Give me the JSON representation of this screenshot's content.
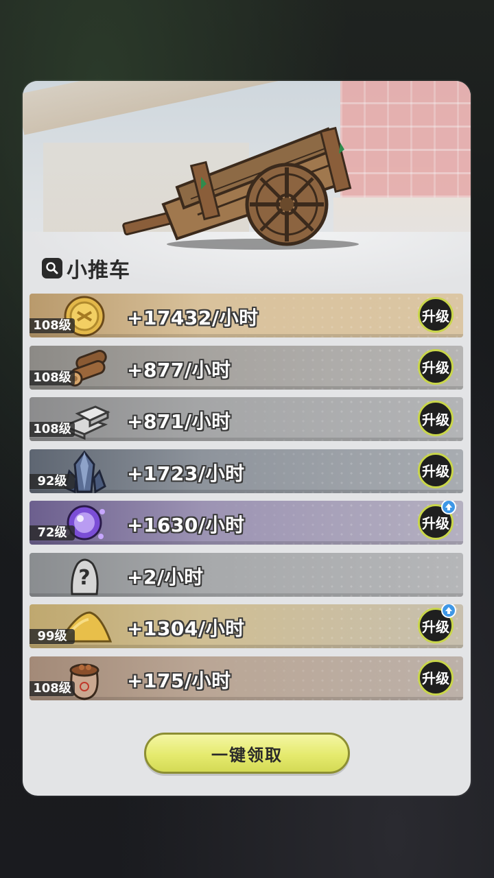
{
  "panel": {
    "title": "小推车",
    "title_icon": "search-icon",
    "scene_image": "wooden-cart"
  },
  "resources": [
    {
      "name": "gold-coin",
      "level": "108级",
      "rate": "+17432/小时",
      "upgrade_label": "升级",
      "upgrade_available": false
    },
    {
      "name": "wood-logs",
      "level": "108级",
      "rate": "+877/小时",
      "upgrade_label": "升级",
      "upgrade_available": false
    },
    {
      "name": "stone-blocks",
      "level": "108级",
      "rate": "+871/小时",
      "upgrade_label": "升级",
      "upgrade_available": false
    },
    {
      "name": "blue-crystal",
      "level": "92级",
      "rate": "+1723/小时",
      "upgrade_label": "升级",
      "upgrade_available": false
    },
    {
      "name": "purple-orb",
      "level": "72级",
      "rate": "+1630/小时",
      "upgrade_label": "升级",
      "upgrade_available": true
    },
    {
      "name": "mystery-item",
      "level": "",
      "rate": "+2/小时",
      "upgrade_label": "",
      "upgrade_available": false
    },
    {
      "name": "sand-pile",
      "level": "99级",
      "rate": "+1304/小时",
      "upgrade_label": "升级",
      "upgrade_available": true
    },
    {
      "name": "food-sack",
      "level": "108级",
      "rate": "+175/小时",
      "upgrade_label": "升级",
      "upgrade_available": false
    }
  ],
  "claim_button": {
    "label": "一键领取"
  },
  "colors": {
    "upgrade_ring": "#c9d64a",
    "claim_button": "#e5ea6e",
    "notify_badge": "#3e97e6"
  }
}
